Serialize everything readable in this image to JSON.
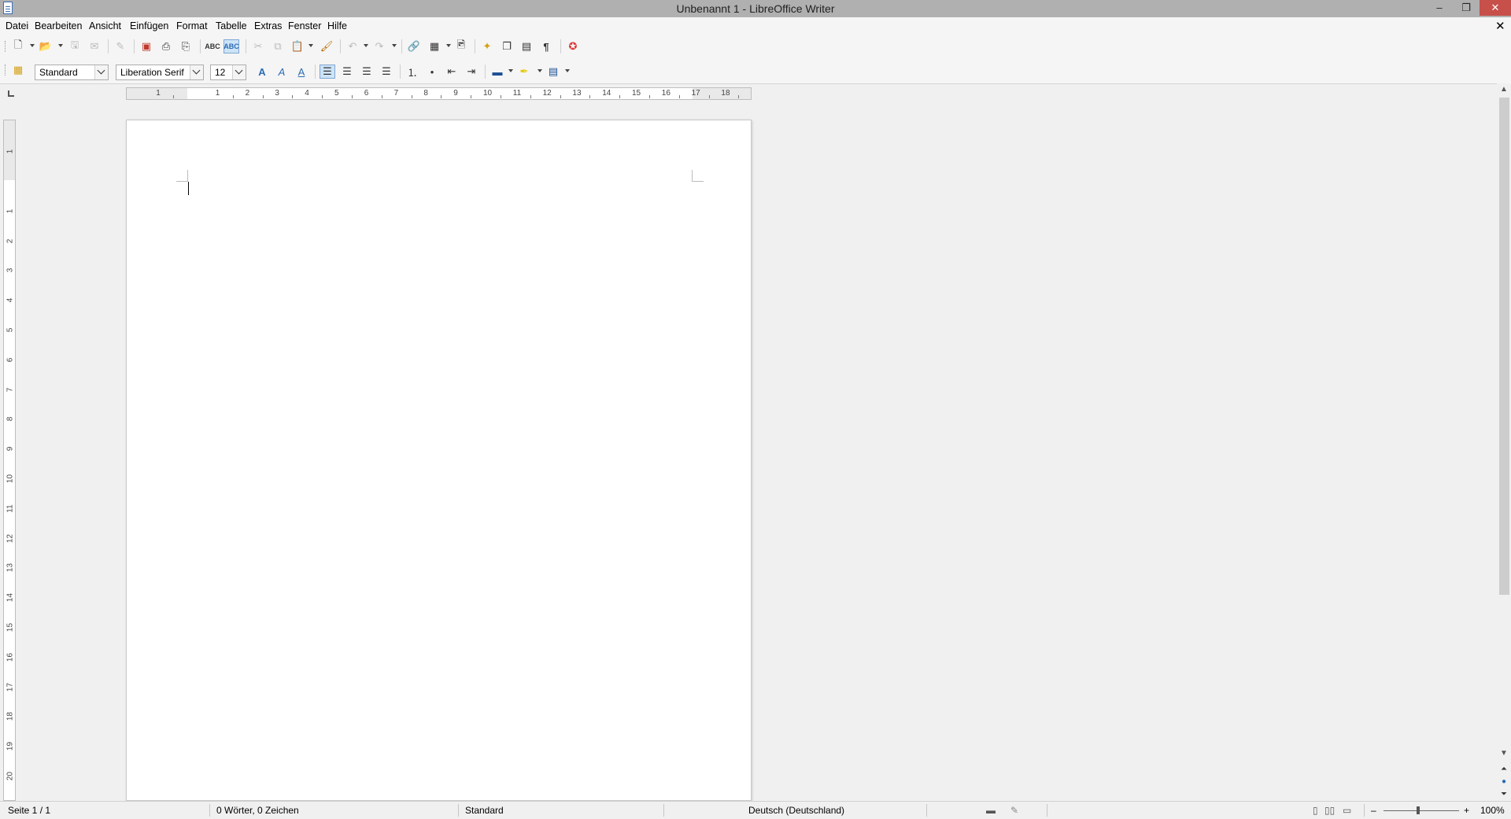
{
  "window": {
    "title": "Unbenannt 1 - LibreOffice Writer",
    "minimize": "–",
    "maximize": "❐",
    "close": "✕"
  },
  "menu": {
    "items": [
      "Datei",
      "Bearbeiten",
      "Ansicht",
      "Einfügen",
      "Format",
      "Tabelle",
      "Extras",
      "Fenster",
      "Hilfe"
    ],
    "close_doc": "✕"
  },
  "formatting": {
    "paragraph_style": "Standard",
    "font_name": "Liberation Serif",
    "font_size": "12"
  },
  "ruler": {
    "h_numbers": [
      "1",
      "1",
      "2",
      "3",
      "4",
      "5",
      "6",
      "7",
      "8",
      "9",
      "10",
      "11",
      "12",
      "13",
      "14",
      "15",
      "16",
      "17",
      "18"
    ],
    "v_numbers": [
      "1",
      "1",
      "2",
      "3",
      "4",
      "5",
      "6",
      "7",
      "8",
      "9",
      "10",
      "11",
      "12",
      "13",
      "14",
      "15",
      "16",
      "17",
      "18",
      "19",
      "20"
    ]
  },
  "status": {
    "page": "Seite 1 / 1",
    "words": "0 Wörter, 0 Zeichen",
    "page_style": "Standard",
    "language": "Deutsch (Deutschland)",
    "zoom": "100%",
    "zoom_minus": "–",
    "zoom_plus": "+"
  },
  "icons": {
    "new": "new-document-icon",
    "open": "open-icon",
    "save": "save-icon",
    "email": "email-icon",
    "edit": "edit-mode-icon",
    "pdf": "export-pdf-icon",
    "print": "print-icon",
    "print_preview": "print-preview-icon",
    "spelling": "spelling-icon",
    "autospell": "autospellcheck-icon",
    "cut": "cut-icon",
    "copy": "copy-icon",
    "paste": "paste-icon",
    "clone": "clone-formatting-icon",
    "undo": "undo-icon",
    "redo": "redo-icon",
    "hyperlink": "hyperlink-icon",
    "table": "table-icon",
    "image": "image-icon",
    "navigator": "navigator-icon",
    "gallery": "gallery-icon",
    "datasource": "data-sources-icon",
    "formatting_marks": "formatting-marks-icon",
    "help": "help-icon"
  }
}
